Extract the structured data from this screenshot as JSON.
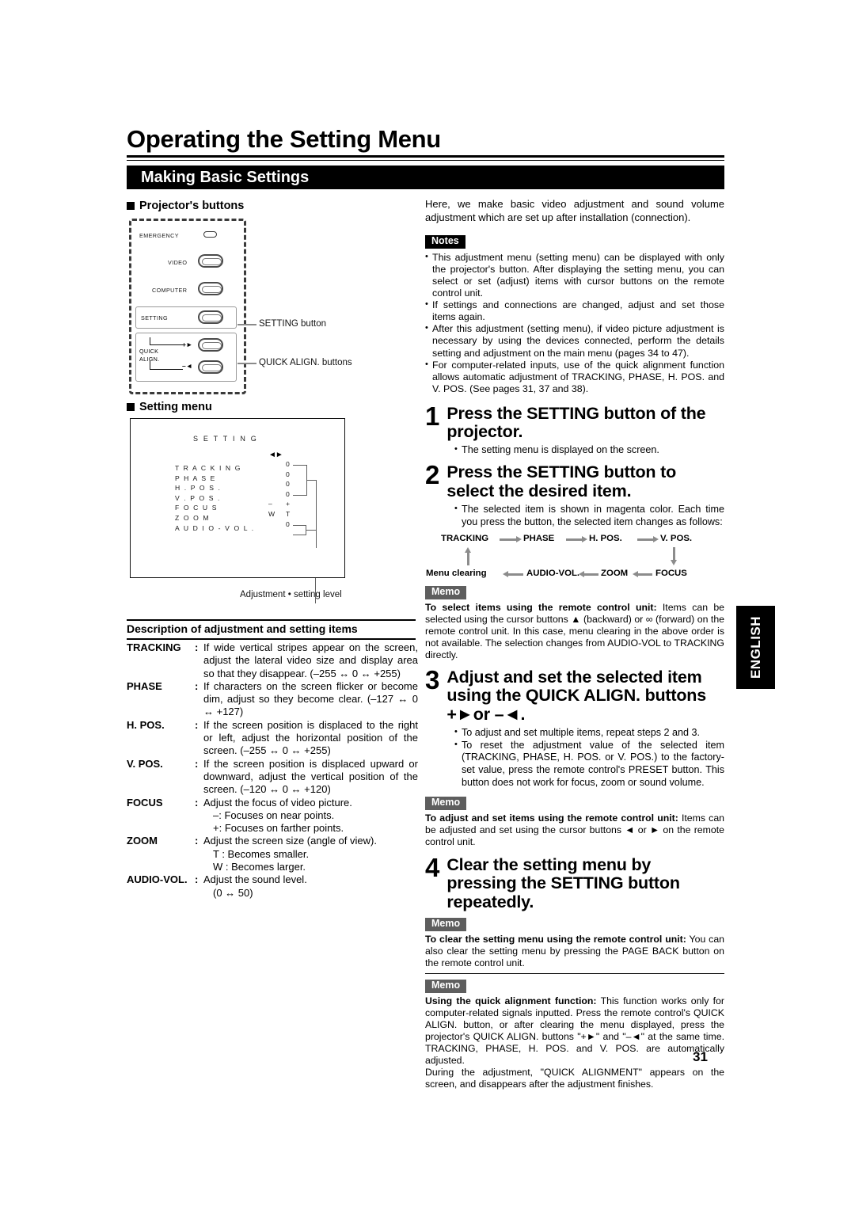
{
  "document": {
    "title": "Operating the Setting Menu",
    "section_bar": "Making Basic Settings",
    "page_number": "31",
    "side_tab": "ENGLISH"
  },
  "left": {
    "projector_buttons_heading": "Projector's buttons",
    "projector_diagram": {
      "labels": {
        "emergency": "EMERGENCY",
        "video": "VIDEO",
        "computer": "COMPUTER",
        "setting": "SETTING",
        "quick": "QUICK",
        "align": "ALIGN.",
        "plus": "+",
        "minus": "–"
      },
      "callouts": {
        "setting_button": "SETTING button",
        "quick_align_buttons": "QUICK ALIGN. buttons"
      }
    },
    "setting_menu_heading": "Setting menu",
    "setting_menu_screen": {
      "title": "S E T T I N G",
      "rows": [
        {
          "name": "T R A C K I N G",
          "col1": "",
          "col2": "0"
        },
        {
          "name": "P H A S E",
          "col1": "",
          "col2": "0"
        },
        {
          "name": "H . P O S .",
          "col1": "",
          "col2": "0"
        },
        {
          "name": "V . P O S .",
          "col1": "",
          "col2": "0"
        },
        {
          "name": "F O C U S",
          "col1": "–",
          "col2": "+"
        },
        {
          "name": "Z O O M",
          "col1": "W",
          "col2": "T"
        },
        {
          "name": "A U D I O  - V O L .",
          "col1": "",
          "col2": "0"
        }
      ],
      "caption": "Adjustment • setting level"
    },
    "description": {
      "heading": "Description of adjustment and setting items",
      "items": [
        {
          "term": "TRACKING",
          "text": "If wide vertical stripes appear on the screen, adjust the lateral video size and display area so that they disappear. (–255 ↔ 0 ↔ +255)",
          "sub": []
        },
        {
          "term": "PHASE",
          "text": "If characters on the screen flicker or become dim, adjust so they become clear. (–127 ↔ 0 ↔ +127)",
          "sub": []
        },
        {
          "term": "H. POS.",
          "text": "If the screen position is displaced to the right or left, adjust the horizontal position of the screen. (–255 ↔ 0 ↔ +255)",
          "sub": []
        },
        {
          "term": "V. POS.",
          "text": "If the screen position is displaced upward or downward, adjust the vertical position of the screen. (–120 ↔ 0 ↔ +120)",
          "sub": []
        },
        {
          "term": "FOCUS",
          "text": "Adjust the focus of video picture.",
          "sub": [
            "–: Focuses on near points.",
            "+: Focuses on farther points."
          ]
        },
        {
          "term": "ZOOM",
          "text": "Adjust the screen size (angle of view).",
          "sub": [
            "T : Becomes smaller.",
            "W : Becomes larger."
          ]
        },
        {
          "term": "AUDIO-VOL.",
          "text": "Adjust the sound level.",
          "sub": [
            "(0 ↔ 50)"
          ]
        }
      ]
    }
  },
  "right": {
    "intro": "Here, we make basic video adjustment and sound volume adjustment which are set up after installation (connection).",
    "notes_tag": "Notes",
    "notes": [
      "This adjustment menu (setting menu) can be displayed with only the projector's button. After displaying the setting menu, you can select or set (adjust) items with cursor buttons on the remote control unit.",
      "If settings and connections are changed, adjust and set those items again.",
      "After this adjustment (setting menu), if video picture adjustment is necessary by using the devices connected, perform the details setting and adjustment on the main menu (pages 34 to 47).",
      "For computer-related inputs, use of the quick alignment function allows automatic adjustment of TRACKING, PHASE, H. POS. and V. POS. (See pages 31, 37 and 38)."
    ],
    "step1": {
      "number": "1",
      "title": "Press the SETTING button of the projector.",
      "bullets": [
        "The setting menu is displayed on the screen."
      ]
    },
    "step2": {
      "number": "2",
      "title": "Press the SETTING button to select the desired item.",
      "bullets": [
        "The selected item is shown in magenta color. Each time you press the button, the selected item changes as follows:"
      ]
    },
    "flow": {
      "top": [
        "TRACKING",
        "PHASE",
        "H. POS.",
        "V. POS."
      ],
      "bottom": [
        "Menu clearing",
        "AUDIO-VOL.",
        "ZOOM",
        "FOCUS"
      ]
    },
    "memo1": {
      "tag": "Memo",
      "title": "To select items using the remote control unit:",
      "text": "Items can be selected using the cursor buttons ▲ (backward) or ∞ (forward) on the remote control unit. In this case, menu clearing in the above order is not available. The selection changes from AUDIO-VOL to TRACKING directly."
    },
    "step3": {
      "number": "3",
      "title": "Adjust and set the selected item using the QUICK ALIGN. buttons +►or –◄.",
      "bullets": [
        "To adjust and set multiple items, repeat steps 2 and 3.",
        "To reset the adjustment value of the selected item (TRACKING, PHASE, H. POS. or V. POS.) to the factory-set value, press the remote control's PRESET button. This button does not work for focus, zoom or sound volume."
      ]
    },
    "memo2": {
      "tag": "Memo",
      "title": "To adjust and set items using the remote control unit:",
      "text": "Items can be adjusted and set using the cursor buttons ◄ or ► on the remote control unit."
    },
    "step4": {
      "number": "4",
      "title": "Clear the setting menu by pressing the SETTING button repeatedly."
    },
    "memo3": {
      "tag": "Memo",
      "title": "To clear the setting menu using the remote control unit:",
      "text": "You can also clear the setting menu by pressing the PAGE BACK button on the remote control unit."
    },
    "memo4": {
      "tag": "Memo",
      "title": "Using the quick alignment function:",
      "text": "This function works only for computer-related signals inputted. Press the remote control's QUICK ALIGN. button, or after clearing the menu displayed, press the projector's QUICK ALIGN. buttons \"+►\" and \"–◄\" at the same time. TRACKING, PHASE, H. POS. and V. POS. are automatically adjusted.",
      "text2": "During the adjustment, \"QUICK ALIGNMENT\" appears on the screen, and disappears after the adjustment finishes."
    }
  },
  "colors": {
    "ink": "#000000",
    "memo_gray": "#5e5e5e",
    "arrow_gray": "#8c8c8c",
    "diagram_gray": "#4a4a4a"
  }
}
